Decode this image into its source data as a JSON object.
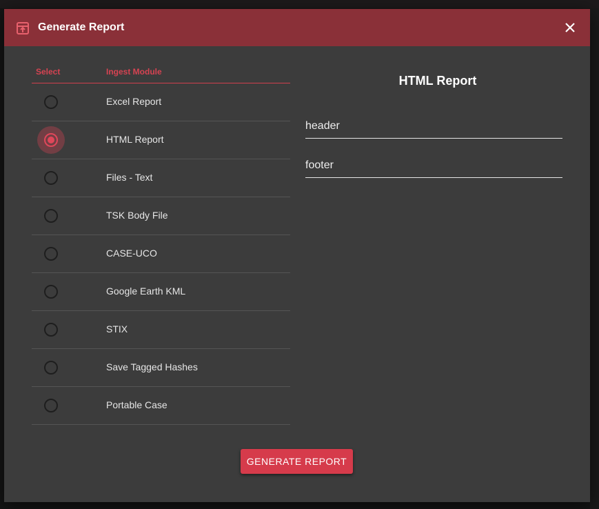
{
  "dialog": {
    "title": "Generate Report",
    "header_icon": "report-export-icon",
    "close_icon": "close-icon"
  },
  "table": {
    "headers": {
      "select": "Select",
      "module": "Ingest Module"
    },
    "rows": [
      {
        "label": "Excel Report",
        "selected": false
      },
      {
        "label": "HTML Report",
        "selected": true
      },
      {
        "label": "Files - Text",
        "selected": false
      },
      {
        "label": "TSK Body File",
        "selected": false
      },
      {
        "label": "CASE-UCO",
        "selected": false
      },
      {
        "label": "Google Earth KML",
        "selected": false
      },
      {
        "label": "STIX",
        "selected": false
      },
      {
        "label": "Save Tagged Hashes",
        "selected": false
      },
      {
        "label": "Portable Case",
        "selected": false
      }
    ]
  },
  "panel": {
    "title": "HTML Report",
    "header_field": {
      "value": "header"
    },
    "footer_field": {
      "value": "footer"
    }
  },
  "actions": {
    "generate_label": "GENERATE REPORT"
  },
  "colors": {
    "header_bg": "#8a3038",
    "accent": "#d63b4b",
    "dialog_bg": "#3c3c3c"
  }
}
